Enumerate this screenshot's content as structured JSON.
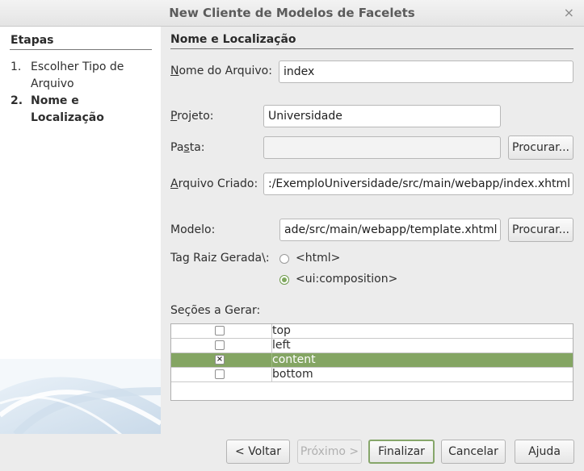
{
  "window": {
    "title": "New Cliente de Modelos de Facelets",
    "close_glyph": "×"
  },
  "steps": {
    "title": "Etapas",
    "items": [
      {
        "num": "1.",
        "label": "Escolher Tipo de Arquivo",
        "active": false
      },
      {
        "num": "2.",
        "label": "Nome e Localização",
        "active": true
      }
    ]
  },
  "main": {
    "title": "Nome e Localização",
    "nome_arquivo": {
      "label_u": "N",
      "label_rest": "ome do Arquivo:",
      "value": "index"
    },
    "projeto": {
      "label_u": "P",
      "label_rest": "rojeto:",
      "value": "Universidade"
    },
    "pasta": {
      "label_pre": "Pa",
      "label_u": "s",
      "label_rest": "ta:",
      "value": "",
      "browse": "Procurar..."
    },
    "arquivo_criado": {
      "label_u": "A",
      "label_rest": "rquivo Criado:",
      "value": ":/ExemploUniversidade/src/main/webapp/index.xhtml"
    },
    "modelo": {
      "label": "Modelo:",
      "value": "ade/src/main/webapp/template.xhtml",
      "browse": "Procurar..."
    },
    "tag_raiz": {
      "label": "Tag Raiz Gerada\\:",
      "options": [
        {
          "label": "<html>",
          "checked": false
        },
        {
          "label": "<ui:composition>",
          "checked": true
        }
      ]
    },
    "secoes": {
      "label": "Seções a Gerar:",
      "rows": [
        {
          "name": "top",
          "checked": false,
          "selected": false
        },
        {
          "name": "left",
          "checked": false,
          "selected": false
        },
        {
          "name": "content",
          "checked": true,
          "selected": true
        },
        {
          "name": "bottom",
          "checked": false,
          "selected": false
        }
      ]
    }
  },
  "buttons": {
    "voltar": "< Voltar",
    "proximo": "Próximo >",
    "finalizar": "Finalizar",
    "cancelar": "Cancelar",
    "ajuda": "Ajuda"
  },
  "colors": {
    "accent": "#84a563",
    "panel": "#ffffff",
    "background": "#ececec"
  }
}
